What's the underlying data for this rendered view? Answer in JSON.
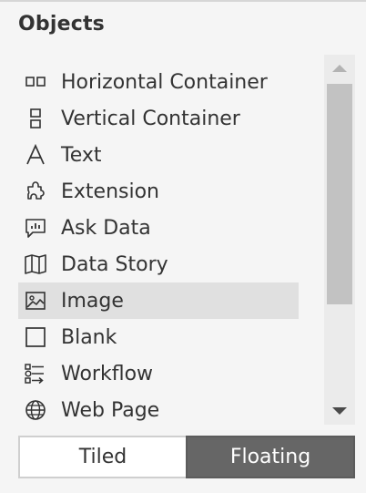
{
  "panel": {
    "title": "Objects"
  },
  "objects": {
    "items": [
      {
        "label": "Horizontal Container",
        "icon": "horizontal-container-icon",
        "selected": false
      },
      {
        "label": "Vertical Container",
        "icon": "vertical-container-icon",
        "selected": false
      },
      {
        "label": "Text",
        "icon": "text-icon",
        "selected": false
      },
      {
        "label": "Extension",
        "icon": "extension-puzzle-icon",
        "selected": false
      },
      {
        "label": "Ask Data",
        "icon": "ask-data-icon",
        "selected": false
      },
      {
        "label": "Data Story",
        "icon": "data-story-book-icon",
        "selected": false
      },
      {
        "label": "Image",
        "icon": "image-icon",
        "selected": true
      },
      {
        "label": "Blank",
        "icon": "blank-icon",
        "selected": false
      },
      {
        "label": "Workflow",
        "icon": "workflow-icon",
        "selected": false
      },
      {
        "label": "Web Page",
        "icon": "globe-icon",
        "selected": false
      }
    ]
  },
  "layout_toggle": {
    "tiled_label": "Tiled",
    "floating_label": "Floating",
    "selected": "Floating"
  },
  "colors": {
    "panel_bg": "#f5f5f5",
    "selected_row": "#e0e0e0",
    "toggle_active": "#666666",
    "text": "#333333"
  }
}
